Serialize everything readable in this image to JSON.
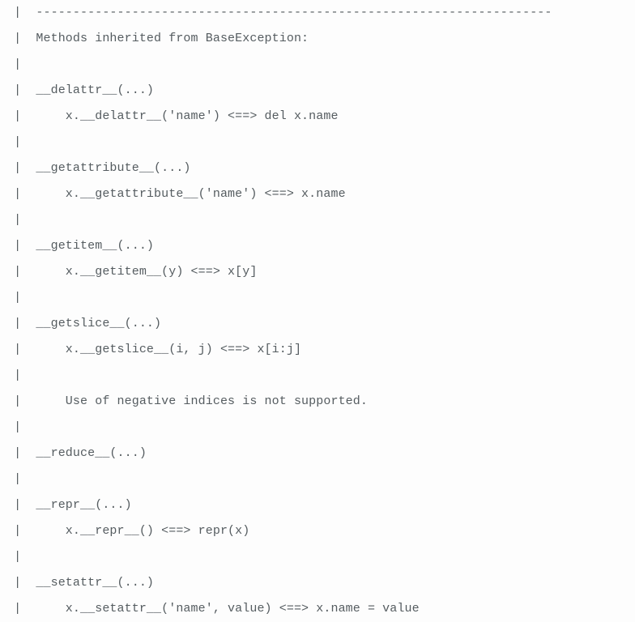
{
  "lines": {
    "l0": " |  ----------------------------------------------------------------------",
    "l1": " |  Methods inherited from BaseException:",
    "l2": " |",
    "l3": " |  __delattr__(...)",
    "l4": " |      x.__delattr__('name') <==> del x.name",
    "l5": " |",
    "l6": " |  __getattribute__(...)",
    "l7": " |      x.__getattribute__('name') <==> x.name",
    "l8": " |",
    "l9": " |  __getitem__(...)",
    "l10": " |      x.__getitem__(y) <==> x[y]",
    "l11": " |",
    "l12": " |  __getslice__(...)",
    "l13": " |      x.__getslice__(i, j) <==> x[i:j]",
    "l14": " |",
    "l15": " |      Use of negative indices is not supported.",
    "l16": " |",
    "l17": " |  __reduce__(...)",
    "l18": " |",
    "l19": " |  __repr__(...)",
    "l20": " |      x.__repr__() <==> repr(x)",
    "l21": " |",
    "l22": " |  __setattr__(...)",
    "l23": " |      x.__setattr__('name', value) <==> x.name = value"
  }
}
